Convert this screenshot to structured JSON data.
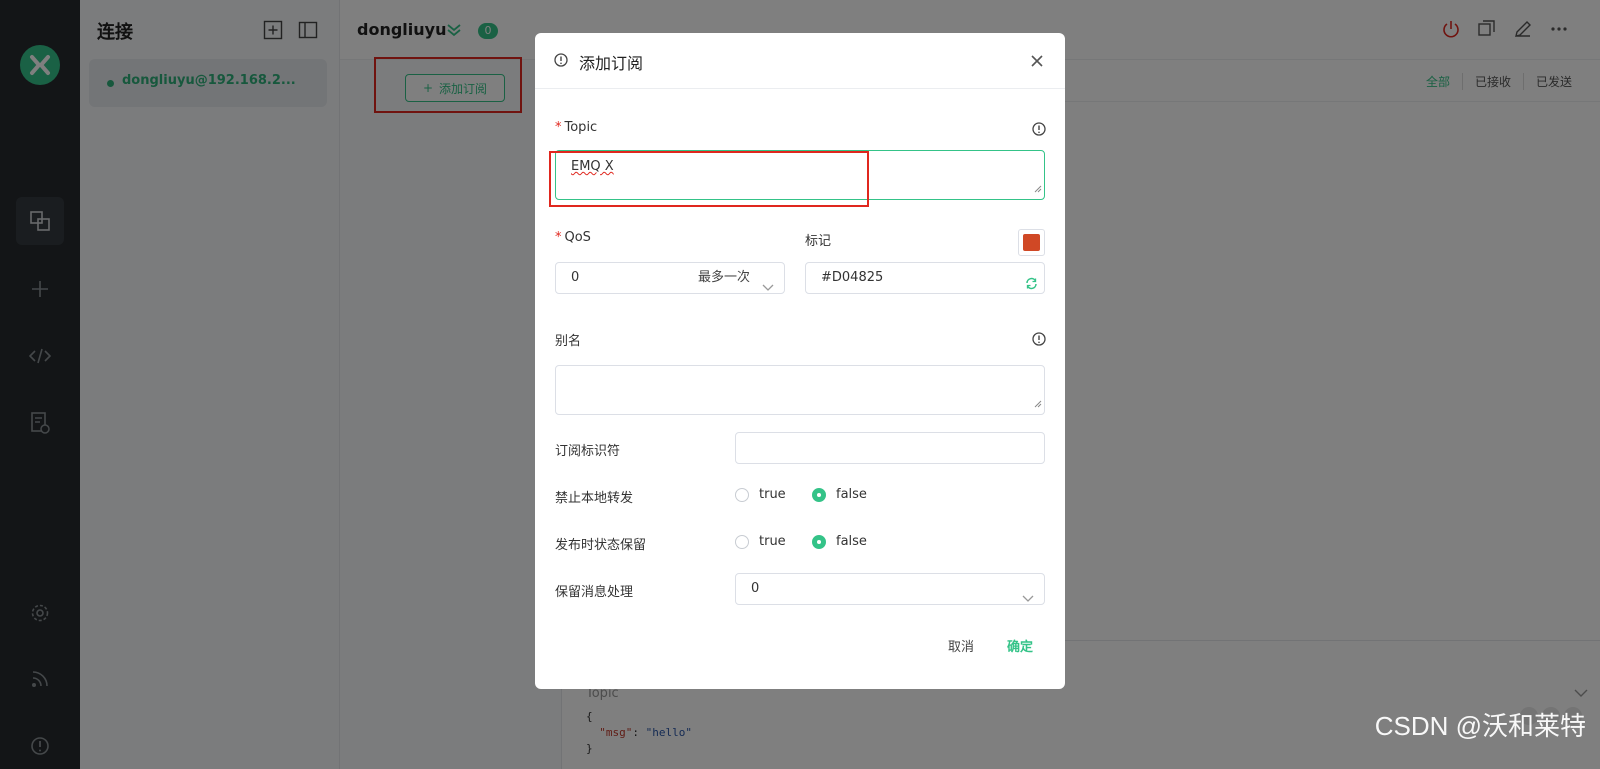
{
  "sidebar": {
    "icons": [
      "logo-icon",
      "connections-icon",
      "new-connection-icon",
      "script-icon",
      "log-icon",
      "settings-icon",
      "feed-icon",
      "about-icon"
    ]
  },
  "connections": {
    "title": "连接",
    "items": [
      {
        "label": "dongliuyu@192.168.2...",
        "status": "connected"
      }
    ]
  },
  "header": {
    "client_name": "dongliuyu",
    "badge_count": "0"
  },
  "subscriptions": {
    "add_button_label": "添加订阅"
  },
  "message_filter": {
    "tabs": [
      "全部",
      "已接收",
      "已发送"
    ]
  },
  "composer": {
    "topic_placeholder": "Topic",
    "payload_lines": [
      "{",
      "  \"msg\": \"hello\"",
      "}"
    ]
  },
  "dialog": {
    "title": "添加订阅",
    "topic_label": "Topic",
    "topic_value": "EMQ X",
    "qos_label": "QoS",
    "qos_value": "0",
    "qos_desc": "最多一次",
    "color_label": "标记",
    "color_value": "#D04825",
    "alias_label": "别名",
    "sub_id_label": "订阅标识符",
    "no_local_label": "禁止本地转发",
    "retain_as_published_label": "发布时状态保留",
    "retain_handling_label": "保留消息处理",
    "retain_handling_value": "0",
    "true_label": "true",
    "false_label": "false",
    "no_local_selected": "false",
    "retain_as_published_selected": "false",
    "cancel_label": "取消",
    "confirm_label": "确定"
  },
  "watermark": "CSDN @沃和莱特",
  "colors": {
    "accent": "#34c388",
    "highlight_red": "#e0271e",
    "marker": "#D04825"
  }
}
